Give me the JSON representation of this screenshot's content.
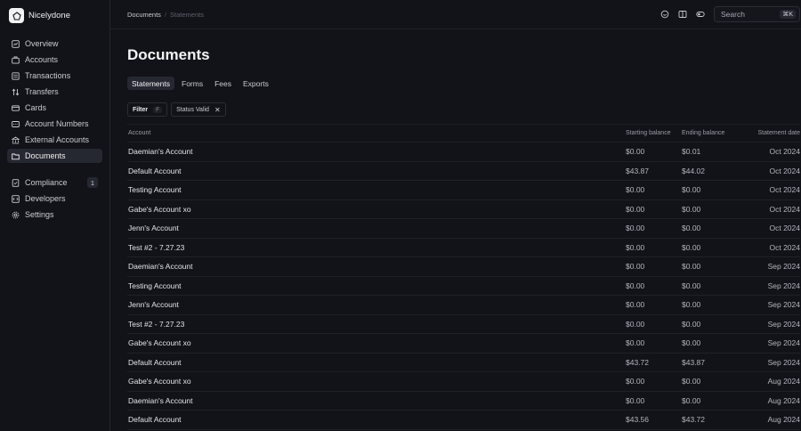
{
  "app": {
    "name": "Nicelydone"
  },
  "sidebar": {
    "items": [
      {
        "label": "Overview",
        "icon": "overview-icon"
      },
      {
        "label": "Accounts",
        "icon": "accounts-icon"
      },
      {
        "label": "Transactions",
        "icon": "transactions-icon"
      },
      {
        "label": "Transfers",
        "icon": "transfers-icon"
      },
      {
        "label": "Cards",
        "icon": "card-icon"
      },
      {
        "label": "Account Numbers",
        "icon": "account-numbers-icon"
      },
      {
        "label": "External Accounts",
        "icon": "external-accounts-icon"
      },
      {
        "label": "Documents",
        "icon": "folder-icon",
        "active": true
      }
    ],
    "secondary": [
      {
        "label": "Compliance",
        "icon": "compliance-icon",
        "badge": "1"
      },
      {
        "label": "Developers",
        "icon": "code-icon"
      },
      {
        "label": "Settings",
        "icon": "gear-icon"
      }
    ]
  },
  "topbar": {
    "breadcrumb": [
      "Documents",
      "Statements"
    ],
    "search": {
      "placeholder": "Search",
      "shortcut": "⌘K"
    }
  },
  "page": {
    "title": "Documents",
    "tabs": [
      "Statements",
      "Forms",
      "Fees",
      "Exports"
    ],
    "active_tab": "Statements",
    "filter": {
      "label": "Filter",
      "key": "F",
      "chip": "Status Valid"
    }
  },
  "table": {
    "columns": [
      "Account",
      "Starting balance",
      "Ending balance",
      "Statement date"
    ],
    "rows": [
      [
        "Daemian's Account",
        "$0.00",
        "$0.01",
        "Oct 2024"
      ],
      [
        "Default Account",
        "$43.87",
        "$44.02",
        "Oct 2024"
      ],
      [
        "Testing Account",
        "$0.00",
        "$0.00",
        "Oct 2024"
      ],
      [
        "Gabe's Account xo",
        "$0.00",
        "$0.00",
        "Oct 2024"
      ],
      [
        "Jenn's Account",
        "$0.00",
        "$0.00",
        "Oct 2024"
      ],
      [
        "Test #2 - 7.27.23",
        "$0.00",
        "$0.00",
        "Oct 2024"
      ],
      [
        "Daemian's Account",
        "$0.00",
        "$0.00",
        "Sep 2024"
      ],
      [
        "Testing Account",
        "$0.00",
        "$0.00",
        "Sep 2024"
      ],
      [
        "Jenn's Account",
        "$0.00",
        "$0.00",
        "Sep 2024"
      ],
      [
        "Test #2 - 7.27.23",
        "$0.00",
        "$0.00",
        "Sep 2024"
      ],
      [
        "Gabe's Account xo",
        "$0.00",
        "$0.00",
        "Sep 2024"
      ],
      [
        "Default Account",
        "$43.72",
        "$43.87",
        "Sep 2024"
      ],
      [
        "Gabe's Account xo",
        "$0.00",
        "$0.00",
        "Aug 2024"
      ],
      [
        "Daemian's Account",
        "$0.00",
        "$0.00",
        "Aug 2024"
      ],
      [
        "Default Account",
        "$43.56",
        "$43.72",
        "Aug 2024"
      ]
    ]
  }
}
